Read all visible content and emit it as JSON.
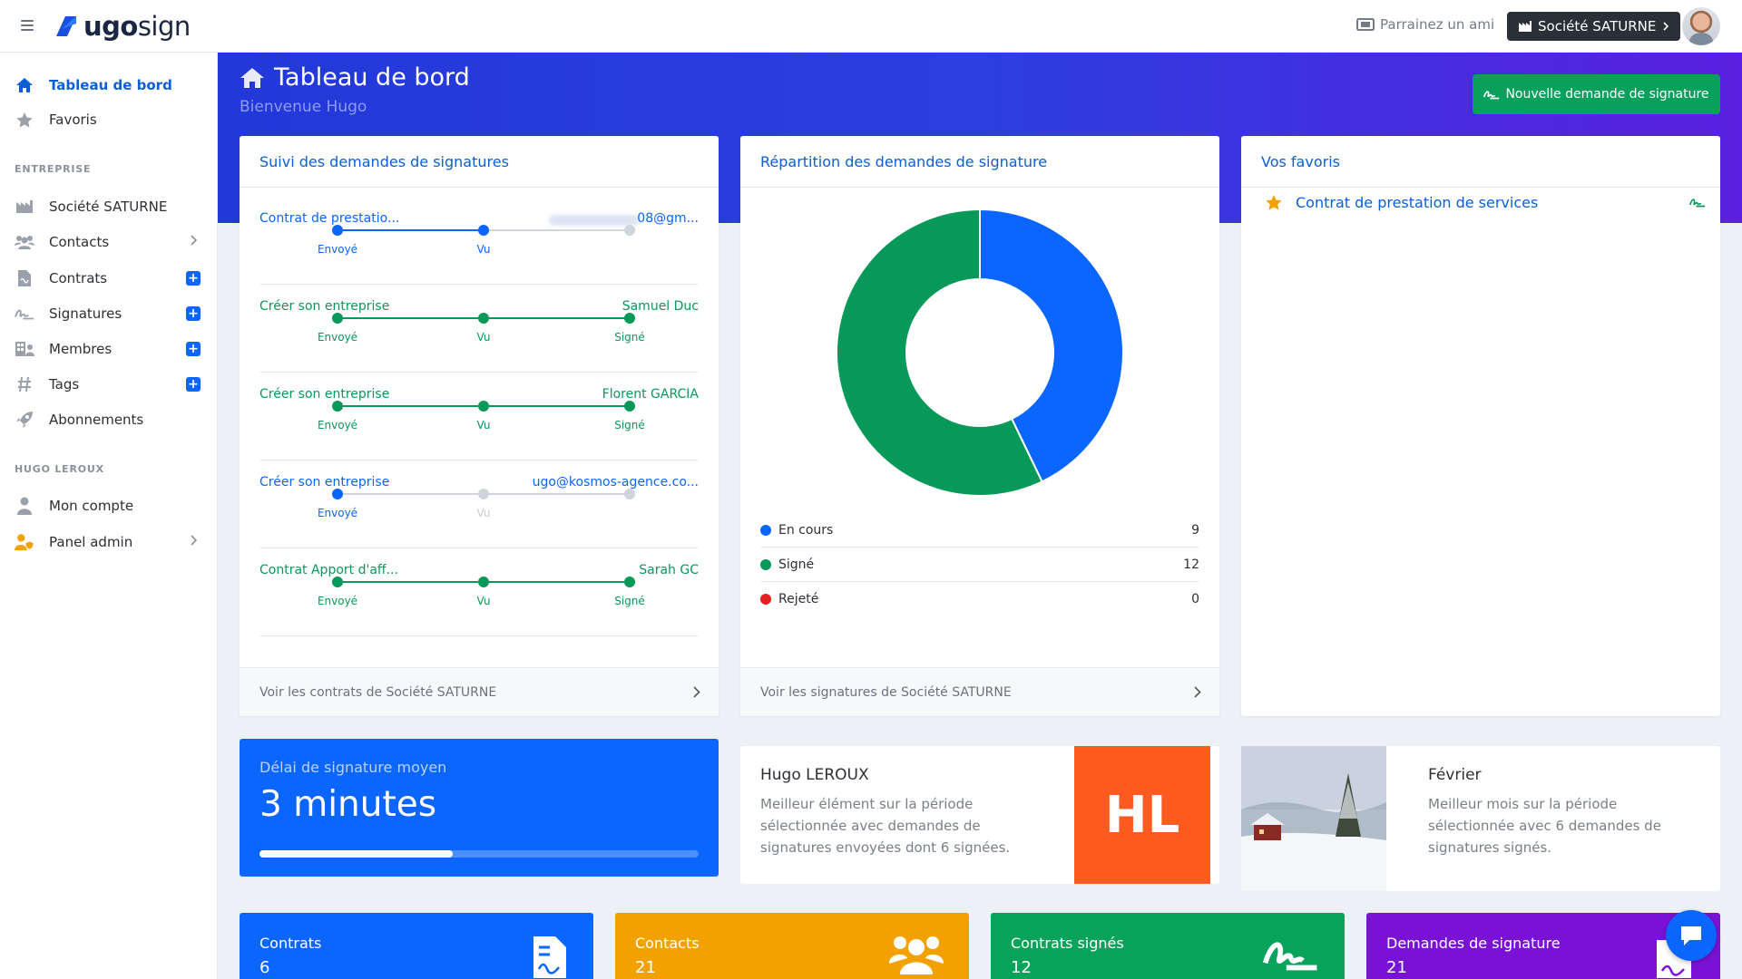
{
  "brand": {
    "name_bold": "ugo",
    "name_light": "sign"
  },
  "topbar": {
    "referral_label": "Parrainez un ami",
    "company_button": "Société SATURNE"
  },
  "sidebar": {
    "items_top": [
      {
        "label": "Tableau de bord",
        "icon": "home-icon"
      },
      {
        "label": "Favoris",
        "icon": "star-icon"
      }
    ],
    "section_company": "ENTREPRISE",
    "items_company": [
      {
        "label": "Société SATURNE",
        "icon": "factory-icon"
      },
      {
        "label": "Contacts",
        "icon": "users-icon"
      },
      {
        "label": "Contrats",
        "icon": "file-icon"
      },
      {
        "label": "Signatures",
        "icon": "signature-icon"
      },
      {
        "label": "Membres",
        "icon": "building-icon"
      },
      {
        "label": "Tags",
        "icon": "hashtag-icon"
      },
      {
        "label": "Abonnements",
        "icon": "rocket-icon"
      }
    ],
    "section_user": "HUGO LEROUX",
    "items_user": [
      {
        "label": "Mon compte",
        "icon": "user-icon"
      },
      {
        "label": "Panel admin",
        "icon": "user-shield-icon"
      }
    ]
  },
  "header": {
    "title": "Tableau de bord",
    "subtitle": "Bienvenue Hugo",
    "new_signature_button": "Nouvelle demande de signature"
  },
  "tracking": {
    "title": "Suivi des demandes de signatures",
    "footer": "Voir les contrats de Société SATURNE",
    "rows": [
      {
        "name": "Contrat de prestatio...",
        "who": "08@gm...",
        "status": [
          "Envoyé",
          "Vu",
          ""
        ],
        "state": "seen"
      },
      {
        "name": "Créer son entreprise",
        "who": "Samuel Duc",
        "status": [
          "Envoyé",
          "Vu",
          "Signé"
        ],
        "state": "signed"
      },
      {
        "name": "Créer son entreprise",
        "who": "Florent GARCIA",
        "status": [
          "Envoyé",
          "Vu",
          "Signé"
        ],
        "state": "signed"
      },
      {
        "name": "Créer son entreprise",
        "who": "ugo@kosmos-agence.co...",
        "status": [
          "Envoyé",
          "Vu",
          ""
        ],
        "state": "sent"
      },
      {
        "name": "Contrat Apport d'aff...",
        "who": "Sarah GC",
        "status": [
          "Envoyé",
          "Vu",
          "Signé"
        ],
        "state": "signed"
      }
    ]
  },
  "distribution": {
    "title": "Répartition des demandes de signature",
    "footer": "Voir les signatures de Société SATURNE",
    "legend": [
      {
        "label": "En cours",
        "value": "9",
        "color": "#0a66ff"
      },
      {
        "label": "Signé",
        "value": "12",
        "color": "#07995a"
      },
      {
        "label": "Rejeté",
        "value": "0",
        "color": "#e5201f"
      }
    ],
    "chart_data": {
      "type": "pie",
      "categories": [
        "En cours",
        "Signé",
        "Rejeté"
      ],
      "values": [
        9,
        12,
        0
      ]
    }
  },
  "favorites": {
    "title": "Vos favoris",
    "items": [
      {
        "label": "Contrat de prestation de services"
      }
    ]
  },
  "avg_delay": {
    "title": "Délai de signature moyen",
    "value": "3 minutes",
    "progress": 0.44
  },
  "best_member": {
    "name": "Hugo LEROUX",
    "description": "Meilleur élément sur la période sélectionnée avec demandes de signatures envoyées dont 6 signées.",
    "initials": "HL"
  },
  "best_month": {
    "name": "Février",
    "description": "Meilleur mois sur la période sélectionnée avec 6 demandes de signatures signés."
  },
  "kpis": [
    {
      "label": "Contrats",
      "value": "6",
      "color": "#0a66ff",
      "icon": "contract-icon"
    },
    {
      "label": "Contacts",
      "value": "21",
      "color": "#f2a100",
      "icon": "users-icon"
    },
    {
      "label": "Contrats signés",
      "value": "12",
      "color": "#07a35a",
      "icon": "signature-icon"
    },
    {
      "label": "Demandes de signature",
      "value": "21",
      "color": "#7a12d6",
      "icon": "sign-request-icon"
    }
  ],
  "colors": {
    "primary": "#0a66ff",
    "success": "#07995a",
    "danger": "#e5201f",
    "accent_orange": "#ff5a1f"
  }
}
